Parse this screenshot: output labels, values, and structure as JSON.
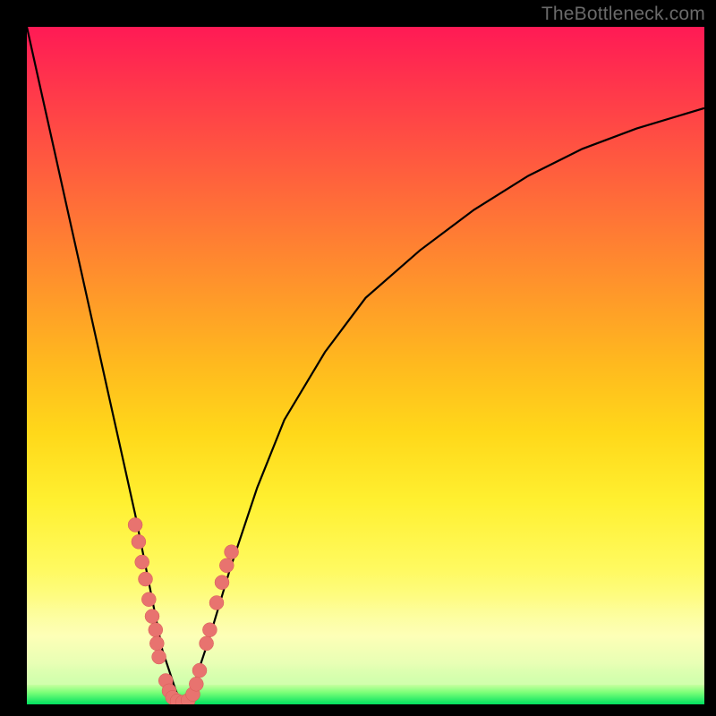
{
  "watermark": "TheBottleneck.com",
  "chart_data": {
    "type": "line",
    "title": "",
    "xlabel": "",
    "ylabel": "",
    "xlim": [
      0,
      100
    ],
    "ylim": [
      0,
      100
    ],
    "grid": false,
    "legend": false,
    "background_gradient": {
      "top": "#ff1a55",
      "mid": "#ffd81a",
      "bottom": "#00e060"
    },
    "series": [
      {
        "name": "left-curve",
        "x": [
          0,
          2,
          4,
          6,
          8,
          10,
          12,
          14,
          16,
          18,
          19,
          20,
          21,
          22,
          23
        ],
        "y": [
          100,
          91,
          82,
          73,
          64,
          55,
          46,
          37,
          28,
          18,
          13,
          8,
          5,
          2,
          0
        ]
      },
      {
        "name": "right-curve",
        "x": [
          23,
          25,
          27,
          30,
          34,
          38,
          44,
          50,
          58,
          66,
          74,
          82,
          90,
          100
        ],
        "y": [
          0,
          4,
          10,
          20,
          32,
          42,
          52,
          60,
          67,
          73,
          78,
          82,
          85,
          88
        ]
      }
    ],
    "points": [
      {
        "x": 16.0,
        "y": 26.5
      },
      {
        "x": 16.5,
        "y": 24.0
      },
      {
        "x": 17.0,
        "y": 21.0
      },
      {
        "x": 17.5,
        "y": 18.5
      },
      {
        "x": 18.0,
        "y": 15.5
      },
      {
        "x": 18.5,
        "y": 13.0
      },
      {
        "x": 19.0,
        "y": 11.0
      },
      {
        "x": 19.2,
        "y": 9.0
      },
      {
        "x": 19.5,
        "y": 7.0
      },
      {
        "x": 20.5,
        "y": 3.5
      },
      {
        "x": 21.0,
        "y": 2.0
      },
      {
        "x": 21.5,
        "y": 1.0
      },
      {
        "x": 22.2,
        "y": 0.5
      },
      {
        "x": 23.0,
        "y": 0.3
      },
      {
        "x": 23.8,
        "y": 0.6
      },
      {
        "x": 24.5,
        "y": 1.5
      },
      {
        "x": 25.0,
        "y": 3.0
      },
      {
        "x": 25.5,
        "y": 5.0
      },
      {
        "x": 26.5,
        "y": 9.0
      },
      {
        "x": 27.0,
        "y": 11.0
      },
      {
        "x": 28.0,
        "y": 15.0
      },
      {
        "x": 28.8,
        "y": 18.0
      },
      {
        "x": 29.5,
        "y": 20.5
      },
      {
        "x": 30.2,
        "y": 22.5
      }
    ]
  }
}
